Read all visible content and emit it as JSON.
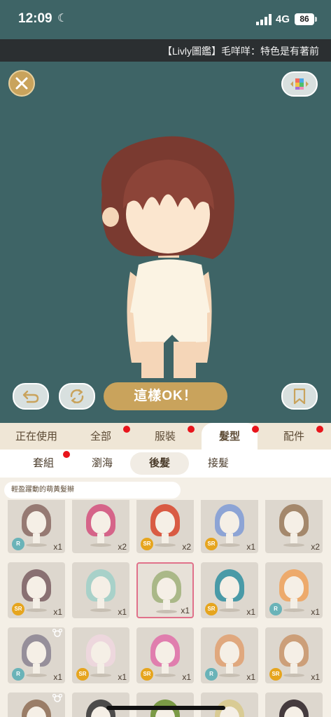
{
  "status_bar": {
    "time": "12:09",
    "network": "4G",
    "battery": "86"
  },
  "ticker": {
    "text": "【Livly圖鑑】毛咩咩：特色是有著前"
  },
  "stage": {
    "ok_label": "這樣OK！"
  },
  "tabs": [
    {
      "label": "正在使用",
      "dot": false
    },
    {
      "label": "全部",
      "dot": true
    },
    {
      "label": "服裝",
      "dot": true
    },
    {
      "label": "髮型",
      "dot": true,
      "active": true
    },
    {
      "label": "配件",
      "dot": true
    }
  ],
  "subtabs": [
    {
      "label": "套組",
      "dot": true
    },
    {
      "label": "瀏海",
      "dot": false
    },
    {
      "label": "後髮",
      "dot": false,
      "active": true
    },
    {
      "label": "接髮",
      "dot": false
    }
  ],
  "description": "輕盈躍動的萌黃髮辮",
  "items": [
    {
      "rarity": "R",
      "qty": "x1",
      "hair": "#8a6a63"
    },
    {
      "rarity": "",
      "qty": "x2",
      "hair": "#d4507d"
    },
    {
      "rarity": "SR",
      "qty": "x2",
      "hair": "#d8452b"
    },
    {
      "rarity": "SR",
      "qty": "x1",
      "hair": "#7f9bd6"
    },
    {
      "rarity": "",
      "qty": "x2",
      "hair": "#9a7a5b"
    },
    {
      "rarity": "SR",
      "qty": "x1",
      "hair": "#7a5e62"
    },
    {
      "rarity": "",
      "qty": "x1",
      "hair": "#9fd0c8"
    },
    {
      "rarity": "",
      "qty": "x1",
      "hair": "#9fb07a",
      "selected": true
    },
    {
      "rarity": "SR",
      "qty": "x1",
      "hair": "#2f8fa0"
    },
    {
      "rarity": "R",
      "qty": "x1",
      "hair": "#f0a25a"
    },
    {
      "rarity": "R",
      "qty": "x1",
      "hair": "#8a8391",
      "paw": true
    },
    {
      "rarity": "SR",
      "qty": "x1",
      "hair": "#f0d7df"
    },
    {
      "rarity": "SR",
      "qty": "x1",
      "hair": "#e06ea8"
    },
    {
      "rarity": "R",
      "qty": "x1",
      "hair": "#e0a070"
    },
    {
      "rarity": "SR",
      "qty": "x1",
      "hair": "#c9956a"
    },
    {
      "rarity": "",
      "qty": "",
      "hair": "#8e6d55",
      "paw": true
    },
    {
      "rarity": "",
      "qty": "",
      "hair": "#333333"
    },
    {
      "rarity": "",
      "qty": "",
      "hair": "#6a8f2e"
    },
    {
      "rarity": "",
      "qty": "",
      "hair": "#d8c98a"
    },
    {
      "rarity": "",
      "qty": "",
      "hair": "#2a2024"
    }
  ]
}
